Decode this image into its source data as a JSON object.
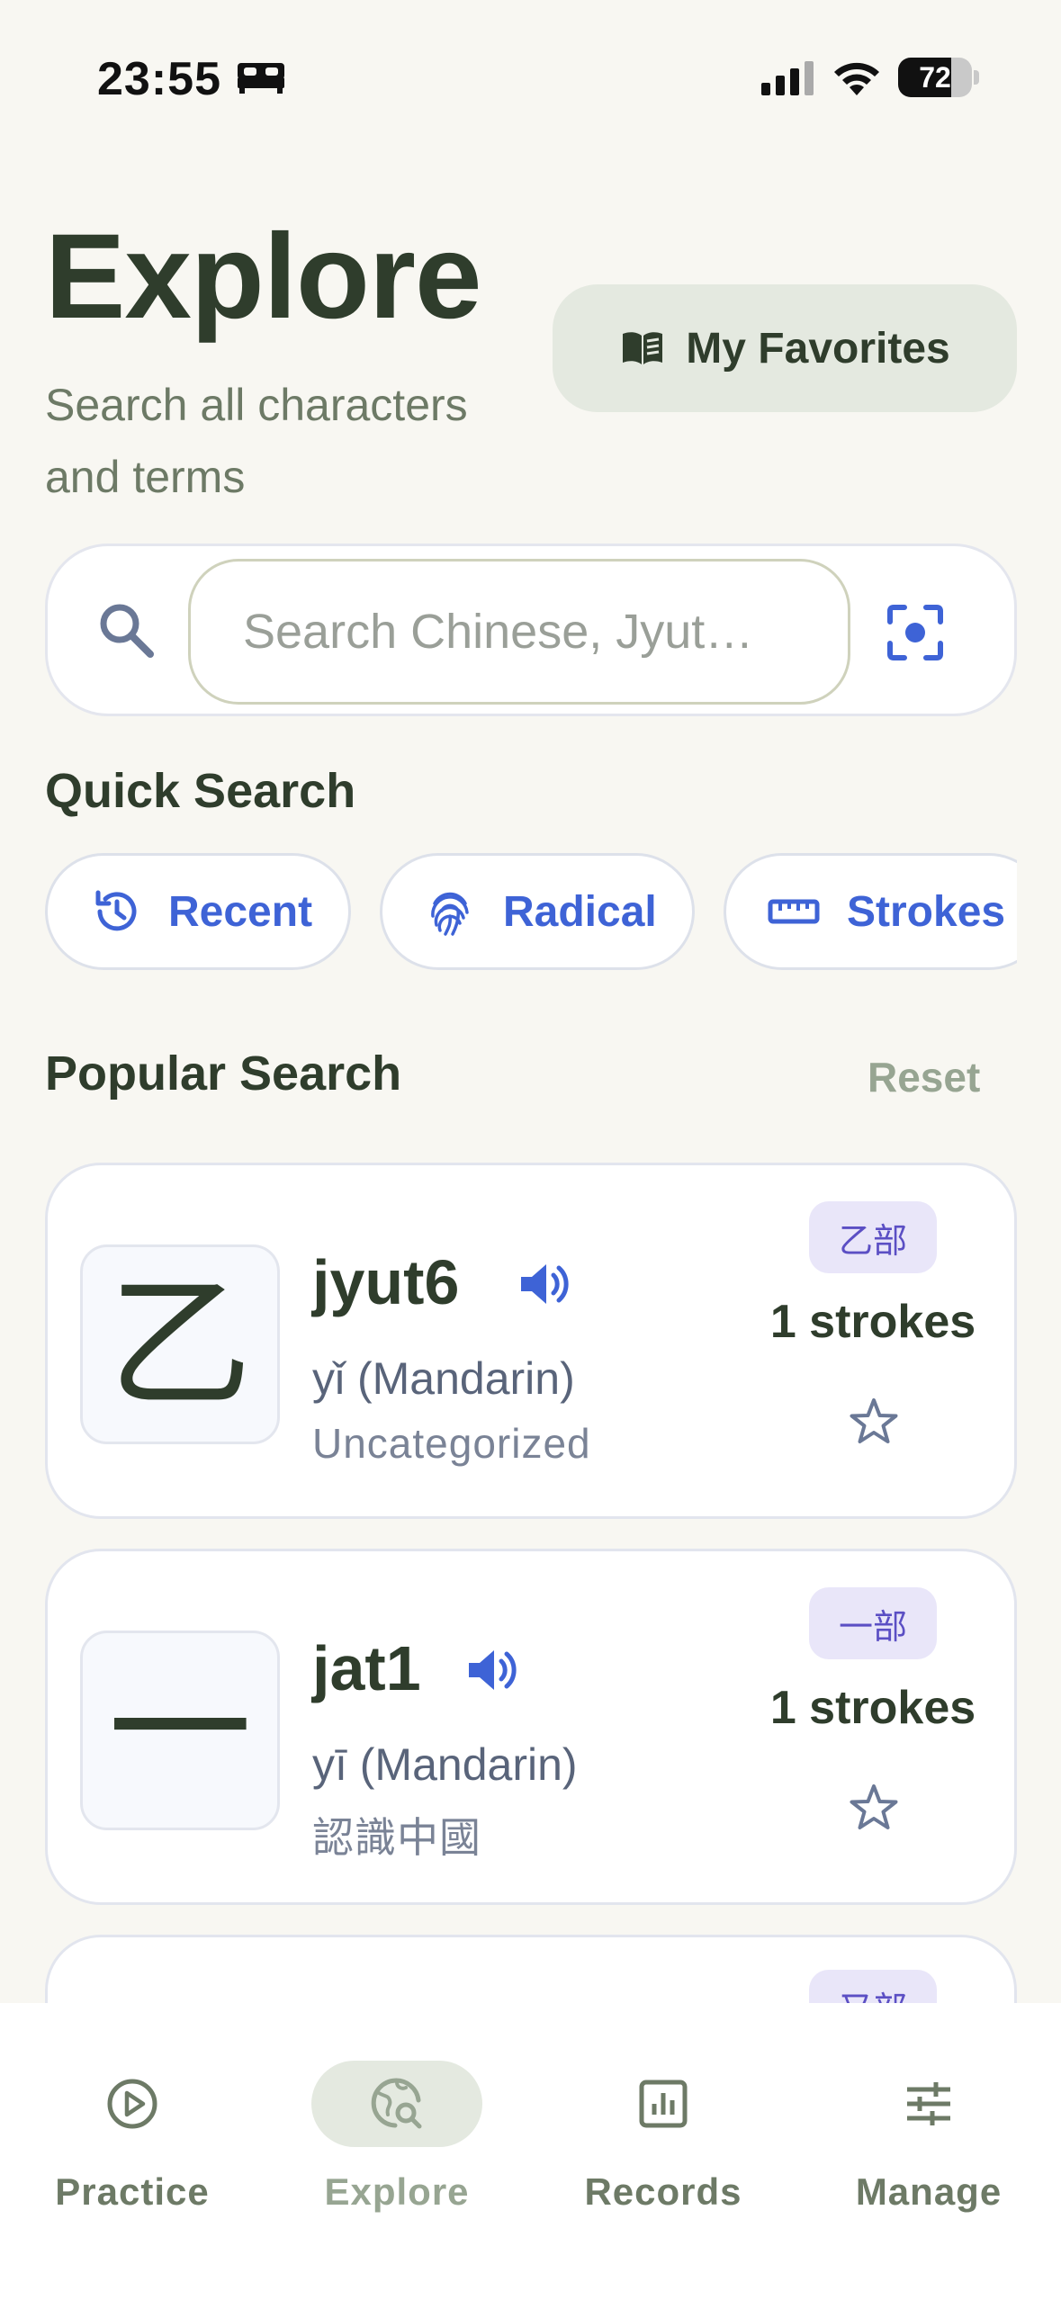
{
  "status_bar": {
    "time": "23:55",
    "battery": "72",
    "battery_level": 0.72
  },
  "header": {
    "title": "Explore",
    "subtitle": "Search all characters and terms",
    "favorites_label": "My Favorites"
  },
  "search": {
    "placeholder": "Search Chinese, Jyut…"
  },
  "quick_search": {
    "title": "Quick Search",
    "chips": [
      {
        "label": "Recent",
        "icon": "history-icon"
      },
      {
        "label": "Radical",
        "icon": "fingerprint-icon"
      },
      {
        "label": "Strokes",
        "icon": "ruler-icon"
      }
    ]
  },
  "popular": {
    "title": "Popular Search",
    "reset_label": "Reset",
    "cards": [
      {
        "character": "乙",
        "jyutping": "jyut6",
        "mandarin": "yǐ (Mandarin)",
        "category": "Uncategorized",
        "radical": "乙部",
        "strokes": "1 strokes"
      },
      {
        "character": "一",
        "jyutping": "jat1",
        "mandarin": "yī (Mandarin)",
        "category": "認識中國",
        "radical": "一部",
        "strokes": "1 strokes"
      },
      {
        "radical": "又部"
      }
    ]
  },
  "nav": {
    "items": [
      {
        "label": "Practice",
        "icon": "play-circle-icon"
      },
      {
        "label": "Explore",
        "icon": "globe-search-icon",
        "active": true
      },
      {
        "label": "Records",
        "icon": "bar-chart-icon"
      },
      {
        "label": "Manage",
        "icon": "sliders-icon"
      }
    ]
  },
  "colors": {
    "background": "#f8f7f2",
    "primary_text": "#2f3d2c",
    "accent_blue": "#3e63d6",
    "badge_bg": "#e9e6f9",
    "badge_text": "#5b4fc4"
  }
}
